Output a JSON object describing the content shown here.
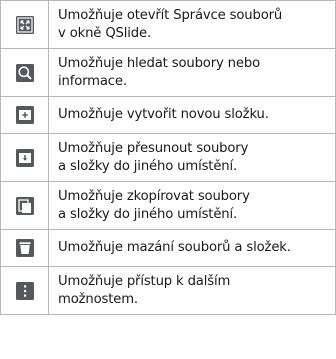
{
  "rows": [
    {
      "icon": "qslide-file-manager-icon",
      "lines": [
        "Umožňuje otevřít Správce souborů",
        "v okně QSlide."
      ]
    },
    {
      "icon": "search-icon",
      "lines": [
        "Umožňuje hledat soubory nebo",
        "informace."
      ]
    },
    {
      "icon": "new-folder-icon",
      "lines": [
        "Umožňuje vytvořit novou složku."
      ]
    },
    {
      "icon": "move-icon",
      "lines": [
        "Umožňuje přesunout soubory",
        "a složky do jiného umístění."
      ]
    },
    {
      "icon": "copy-icon",
      "lines": [
        "Umožňuje zkopírovat soubory",
        "a složky do jiného umístění."
      ]
    },
    {
      "icon": "trash-icon",
      "lines": [
        "Umožňuje mazání souborů a složek."
      ]
    },
    {
      "icon": "more-options-icon",
      "lines": [
        "Umožňuje přístup k dalším",
        "možnostem."
      ]
    }
  ],
  "colors": {
    "icon_bg": "#55595c",
    "icon_fg": "#ffffff",
    "border": "#b7b7b7",
    "text": "#1a1a1a"
  }
}
